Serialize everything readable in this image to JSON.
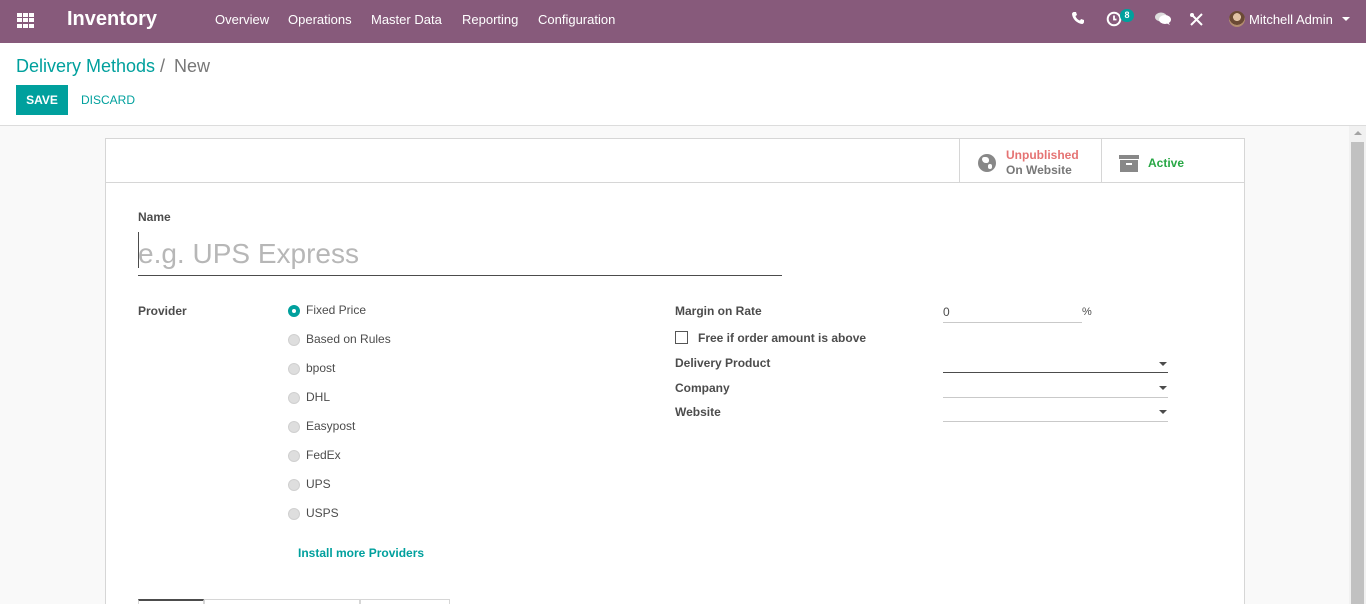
{
  "navbar": {
    "app_name": "Inventory",
    "menu": [
      "Overview",
      "Operations",
      "Master Data",
      "Reporting",
      "Configuration"
    ],
    "activity_count": "8",
    "user_name": "Mitchell Admin",
    "icons": [
      "apps-icon",
      "phone-icon",
      "activity-clock-icon",
      "chat-icon",
      "debug-tools-icon",
      "user-avatar",
      "chevron-down-icon"
    ]
  },
  "breadcrumb": {
    "parent": "Delivery Methods",
    "separator": "/",
    "current": "New"
  },
  "actions": {
    "save": "SAVE",
    "discard": "DISCARD"
  },
  "smart_buttons": {
    "website_status": "Unpublished",
    "website_sub": "On Website",
    "active": "Active"
  },
  "form": {
    "name_label": "Name",
    "name_placeholder": "e.g. UPS Express",
    "name_value": "",
    "provider_label": "Provider",
    "providers": [
      {
        "label": "Fixed Price",
        "selected": true
      },
      {
        "label": "Based on Rules",
        "selected": false
      },
      {
        "label": "bpost",
        "selected": false
      },
      {
        "label": "DHL",
        "selected": false
      },
      {
        "label": "Easypost",
        "selected": false
      },
      {
        "label": "FedEx",
        "selected": false
      },
      {
        "label": "UPS",
        "selected": false
      },
      {
        "label": "USPS",
        "selected": false
      }
    ],
    "install_more": "Install more Providers",
    "margin_label": "Margin on Rate",
    "margin_value": "0",
    "margin_unit": "%",
    "free_label": "Free if order amount is above",
    "free_checked": false,
    "delivery_product_label": "Delivery Product",
    "delivery_product_value": "",
    "company_label": "Company",
    "company_value": "",
    "website_label": "Website",
    "website_value": ""
  },
  "colors": {
    "brand": "#875a7b",
    "accent": "#00a09d",
    "unpublished": "#e57373",
    "active": "#28a745"
  }
}
